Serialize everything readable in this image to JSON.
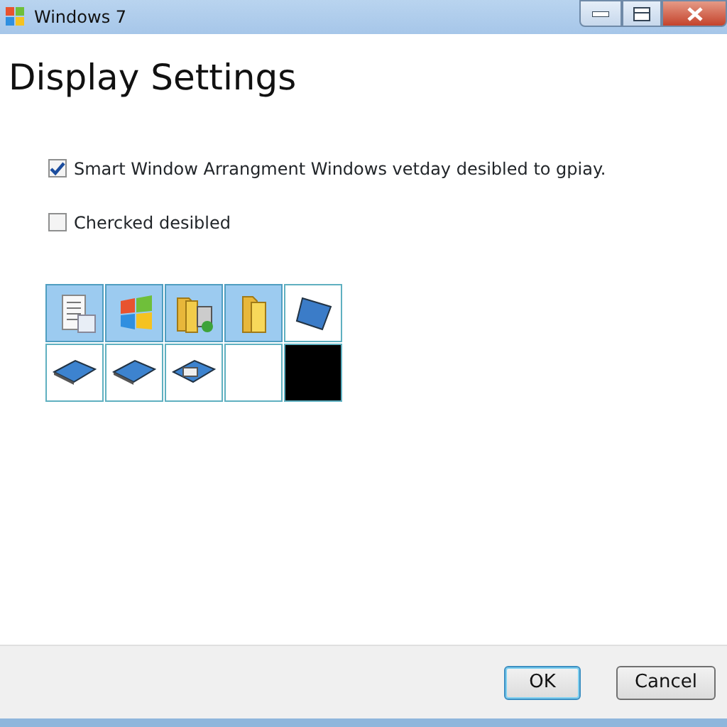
{
  "window": {
    "title": "Windows 7"
  },
  "heading": "Display Settings",
  "options": [
    {
      "label": "Smart Window Arrangment Windows vetday desibled to gpiay.",
      "checked": true
    },
    {
      "label": "Chercked desibled",
      "checked": false
    }
  ],
  "tiles": [
    {
      "kind": "document",
      "selected": true
    },
    {
      "kind": "flag",
      "selected": true
    },
    {
      "kind": "folders",
      "selected": true
    },
    {
      "kind": "folder",
      "selected": true
    },
    {
      "kind": "panel",
      "selected": false
    },
    {
      "kind": "slab",
      "selected": false
    },
    {
      "kind": "slab",
      "selected": false
    },
    {
      "kind": "slabdoc",
      "selected": false
    },
    {
      "kind": "empty",
      "selected": false
    },
    {
      "kind": "dark",
      "selected": false
    }
  ],
  "buttons": [
    {
      "label": "OK",
      "kind": "default"
    },
    {
      "label": "Cancel",
      "kind": "normal"
    }
  ]
}
